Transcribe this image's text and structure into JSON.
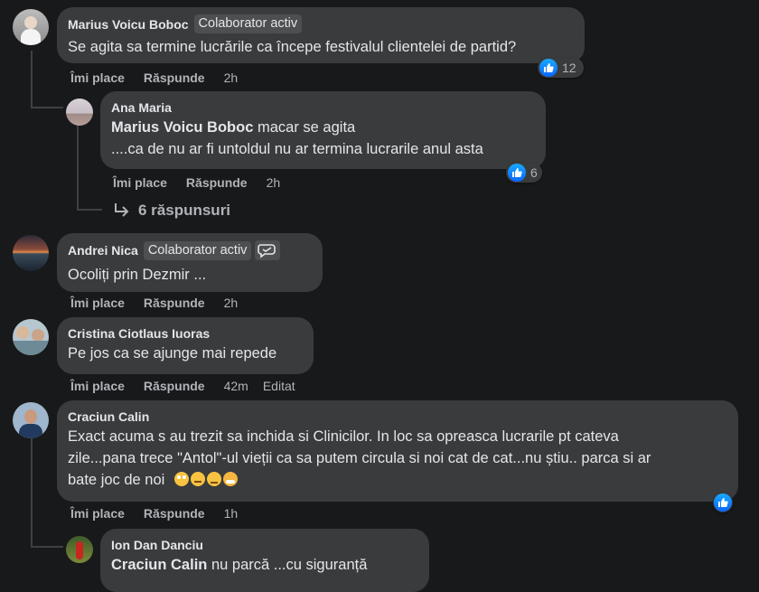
{
  "colors": {
    "background": "#18191a",
    "bubble": "#3a3b3c",
    "text": "#e4e6eb",
    "muted": "#b0b3b8",
    "like": "#0866ff"
  },
  "actions": {
    "like": "Îmi place",
    "reply": "Răspunde"
  },
  "comments": [
    {
      "author": "Marius Voicu Boboc",
      "badge": "Colaborator activ",
      "lines": [
        "Se agita sa termine lucrările ca începe festivalul clientelei de partid?"
      ],
      "time": "2h",
      "reactions": "12"
    },
    {
      "author": "Ana Maria",
      "mention": "Marius Voicu Boboc",
      "lines": [
        "macar se agita",
        "....ca de nu ar fi untoldul nu ar termina lucrarile anul asta"
      ],
      "time": "2h",
      "reactions": "6"
    },
    {
      "author": "Andrei Nica",
      "badge": "Colaborator activ",
      "badge_icon": "chat-bubble-icon",
      "lines": [
        "Ocoliți prin Dezmir ..."
      ],
      "time": "2h"
    },
    {
      "author": "Cristina Ciotlaus Iuoras",
      "lines": [
        "Pe jos ca se ajunge mai repede"
      ],
      "time": "42m",
      "edited": "Editat"
    },
    {
      "author": "Craciun Calin",
      "lines": [
        "Exact acuma s au trezit sa inchida si Clinicilor. In loc sa opreasca lucrarile pt cateva",
        "zile...pana trece \"Antol\"-ul vieții ca sa putem circula si noi cat de cat...nu știu.. parca si ar",
        "bate joc de noi"
      ],
      "emojis": [
        "face-with-rolling-eyes",
        "sad-face",
        "unamused-face",
        "persevering-face"
      ],
      "time": "1h"
    },
    {
      "author": "Ion Dan Danciu",
      "mention": "Craciun Calin",
      "lines": [
        "nu parcă ...cu siguranță"
      ]
    }
  ],
  "replies_link": "6 răspunsuri"
}
